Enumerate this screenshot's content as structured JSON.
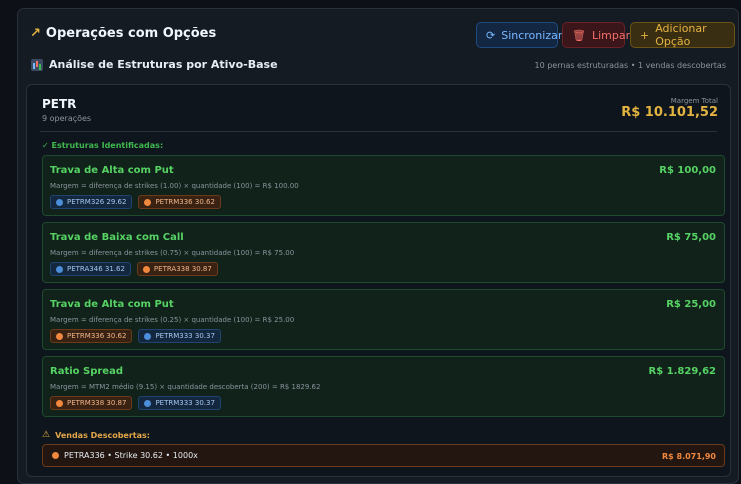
{
  "header": {
    "title": "Operações com Opções",
    "icon": "trending-up-icon"
  },
  "toolbar": {
    "sync_label": "Sincronizar",
    "clear_label": "Limpar",
    "add_label": "Adicionar Opção"
  },
  "analysis": {
    "title": "Análise de Estruturas por Ativo-Base",
    "summary": "10 pernas estruturadas • 1 vendas descobertas"
  },
  "asset": {
    "name": "PETR",
    "operations": "9 operações",
    "margin_label": "Margem Total",
    "margin_value": "R$ 10.101,52",
    "structures_title": "✓ Estruturas Identificadas:",
    "structures": [
      {
        "name": "Trava de Alta com Put",
        "value": "R$ 100,00",
        "description": "Margem = diferença de strikes (1.00) × quantidade (100) = R$ 100.00",
        "legs": [
          {
            "label": "PETRM326 29.62",
            "side": "buy"
          },
          {
            "label": "PETRM336 30.62",
            "side": "sell"
          }
        ]
      },
      {
        "name": "Trava de Baixa com Call",
        "value": "R$ 75,00",
        "description": "Margem = diferença de strikes (0.75) × quantidade (100) = R$ 75.00",
        "legs": [
          {
            "label": "PETRA346 31.62",
            "side": "buy"
          },
          {
            "label": "PETRA338 30.87",
            "side": "sell"
          }
        ]
      },
      {
        "name": "Trava de Alta com Put",
        "value": "R$ 25,00",
        "description": "Margem = diferença de strikes (0.25) × quantidade (100) = R$ 25.00",
        "legs": [
          {
            "label": "PETRM336 30.62",
            "side": "sell"
          },
          {
            "label": "PETRM333 30.37",
            "side": "buy"
          }
        ]
      },
      {
        "name": "Ratio Spread",
        "value": "R$ 1.829,62",
        "description": "Margem = MTM2 médio (9.15) × quantidade descoberta (200) = R$ 1829.62",
        "legs": [
          {
            "label": "PETRM338 30.87",
            "side": "sell"
          },
          {
            "label": "PETRM333 30.37",
            "side": "buy"
          }
        ]
      }
    ],
    "naked_title": "Vendas Descobertas:",
    "naked": {
      "label": "PETRA336 • Strike 30.62 • 1000x",
      "value": "R$ 8.071,90"
    }
  },
  "colors": {
    "accent_gold": "#e3b341",
    "structure_green": "#56d364",
    "sell_orange": "#f0883e",
    "buy_blue": "#4c8eda"
  }
}
